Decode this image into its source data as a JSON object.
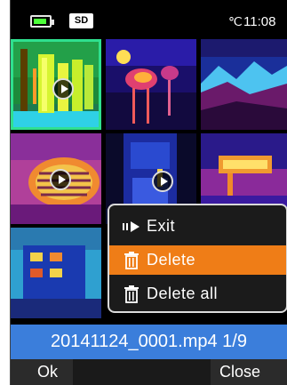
{
  "status_bar": {
    "battery_icon": "battery-icon",
    "sd_label": "SD",
    "temp_unit": "℃",
    "time": "11:08"
  },
  "thumbnails": [
    {
      "name": "thumb-1",
      "kind": "video",
      "selected": true
    },
    {
      "name": "thumb-2",
      "kind": "image"
    },
    {
      "name": "thumb-3",
      "kind": "image"
    },
    {
      "name": "thumb-4",
      "kind": "video"
    },
    {
      "name": "thumb-5",
      "kind": "video"
    },
    {
      "name": "thumb-6",
      "kind": "image"
    },
    {
      "name": "thumb-7",
      "kind": "image"
    }
  ],
  "menu": {
    "items": [
      {
        "label": "Exit",
        "icon": "exit-icon"
      },
      {
        "label": "Delete",
        "icon": "trash-icon",
        "highlighted": true
      },
      {
        "label": "Delete all",
        "icon": "trash-all-icon"
      }
    ]
  },
  "file": {
    "name_and_index": "20141124_0001.mp4 1/9"
  },
  "softkeys": {
    "left": "Ok",
    "right": "Close"
  },
  "colors": {
    "selection": "#2fe08f",
    "menu_highlight": "#ef7d17",
    "filename_bar": "#3b7edb"
  }
}
